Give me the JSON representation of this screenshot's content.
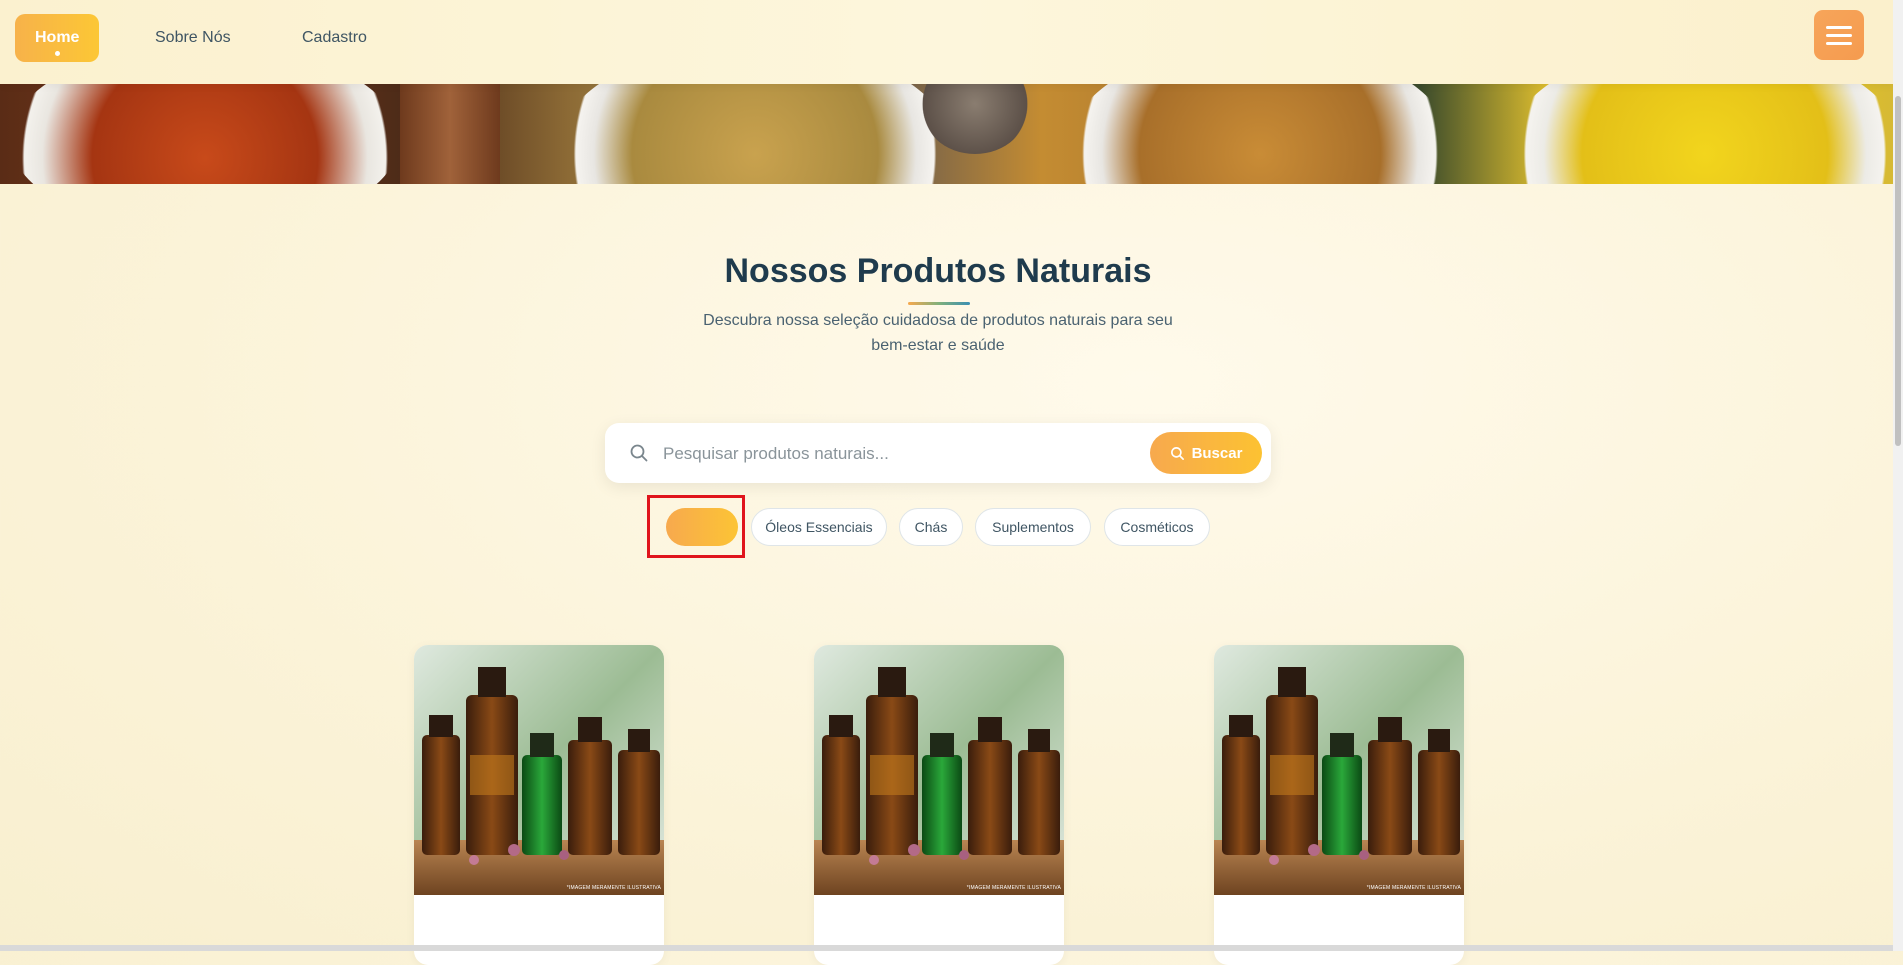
{
  "nav": {
    "links": [
      {
        "label": "Home",
        "active": true
      },
      {
        "label": "Sobre Nós",
        "active": false
      },
      {
        "label": "Cadastro",
        "active": false
      }
    ],
    "menu_icon": "hamburger-menu-icon"
  },
  "hero": {
    "description": "spice bowls banner"
  },
  "products_section": {
    "title": "Nossos Produtos Naturais",
    "subtitle": "Descubra nossa seleção cuidadosa de produtos naturais para seu bem-estar e saúde"
  },
  "search": {
    "placeholder": "Pesquisar produtos naturais...",
    "value": "",
    "button_label": "Buscar",
    "icon": "search-icon"
  },
  "categories": [
    {
      "label": "",
      "active": true
    },
    {
      "label": "Óleos Essenciais",
      "active": false
    },
    {
      "label": "Chás",
      "active": false
    },
    {
      "label": "Suplementos",
      "active": false
    },
    {
      "label": "Cosméticos",
      "active": false
    }
  ],
  "products": [
    {
      "image": "essential-oil-bottles",
      "watermark": "*IMAGEM MERAMENTE ILUSTRATIVA"
    },
    {
      "image": "essential-oil-bottles",
      "watermark": "*IMAGEM MERAMENTE ILUSTRATIVA"
    },
    {
      "image": "essential-oil-bottles",
      "watermark": "*IMAGEM MERAMENTE ILUSTRATIVA"
    }
  ],
  "colors": {
    "accent_orange": "#f7a94e",
    "accent_yellow": "#fcc435",
    "title_navy": "#1f3b4d",
    "highlight_red": "#e0141c"
  }
}
